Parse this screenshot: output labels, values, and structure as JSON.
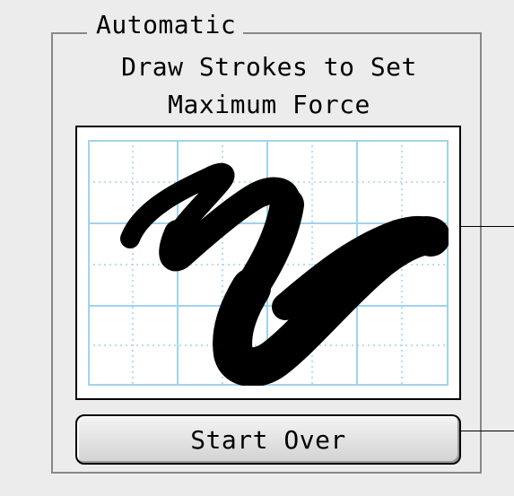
{
  "group": {
    "title": "Automatic"
  },
  "instructions": {
    "line1": "Draw Strokes to Set",
    "line2": "Maximum Force"
  },
  "drawing_area": {
    "grid_color": "#9fd3ec",
    "stroke_color": "#000000"
  },
  "buttons": {
    "start_over": "Start Over"
  }
}
